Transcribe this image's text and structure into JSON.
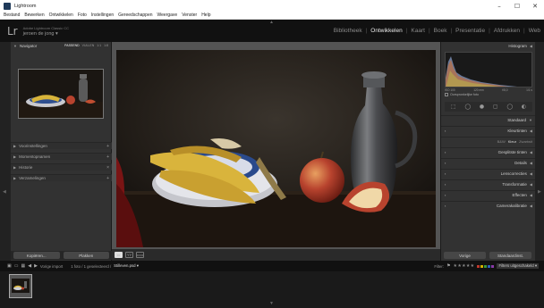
{
  "window": {
    "title": "Lightroom",
    "controls": [
      "–",
      "☐",
      "✕"
    ]
  },
  "menubar": [
    "Bestand",
    "Bewerken",
    "Ontwikkelen",
    "Foto",
    "Instellingen",
    "Gereedschappen",
    "Weergave",
    "Venster",
    "Help"
  ],
  "identity": {
    "logo": "Lr",
    "account_line": "Adobe Lightroom Classic CC",
    "user_name": "jeroen de jong ▾",
    "modules": [
      "Bibliotheek",
      "Ontwikkelen",
      "Kaart",
      "Boek",
      "Presentatie",
      "Afdrukken",
      "Web"
    ],
    "active_module": "Ontwikkelen"
  },
  "left_panel": {
    "navigator": {
      "title": "Navigator",
      "zoom_options": [
        "PASSEND",
        "VULLEN",
        "1:1",
        "1:8"
      ],
      "active_zoom": "PASSEND"
    },
    "sections": [
      "Voorinstellingen",
      "Momentopnamen",
      "Historie",
      "Verzamelingen"
    ],
    "buttons": {
      "copy": "Kopiëren...",
      "paste": "Plakken"
    }
  },
  "center_toolbar": {
    "views": [
      "▭",
      "YY",
      "▭▭"
    ]
  },
  "right_panel": {
    "histogram_title": "Histogram",
    "histogram_info": [
      "ISO 100",
      "120 mm",
      "f/8,0",
      "1/1 s"
    ],
    "original_photo": "Oorspronkelijke foto",
    "tools": [
      "⬚",
      "◯",
      "●",
      "▢",
      "◯",
      "◐"
    ],
    "basic_title": "Standaard",
    "profile_row": [
      "B&W",
      "Kleur",
      "Zwartwit"
    ],
    "sections": [
      "Kleurtinten",
      "Gesplitste tinten",
      "Details",
      "Lenscorrecties",
      "Transformatie",
      "Effecten",
      "Camerakalibratie"
    ],
    "buttons": {
      "previous": "Vorige",
      "reset": "Standaardinst."
    }
  },
  "filmstrip_bar": {
    "import_label": "Vorige import",
    "count_text": "1 foto / 1 geselecteerd /",
    "filename": "Stilleven.psd ▾",
    "filter_label": "Filter:",
    "stars": "★★★★★",
    "filter_select": "Filters uitgeschakeld ▾",
    "color_dots": [
      "#c0392b",
      "#d4b000",
      "#3a9a3a",
      "#2a5fbf",
      "#8a3aa8"
    ]
  },
  "colors": {
    "accent": "#eaeaea",
    "panel": "#323232",
    "center_bg": "#545454"
  }
}
